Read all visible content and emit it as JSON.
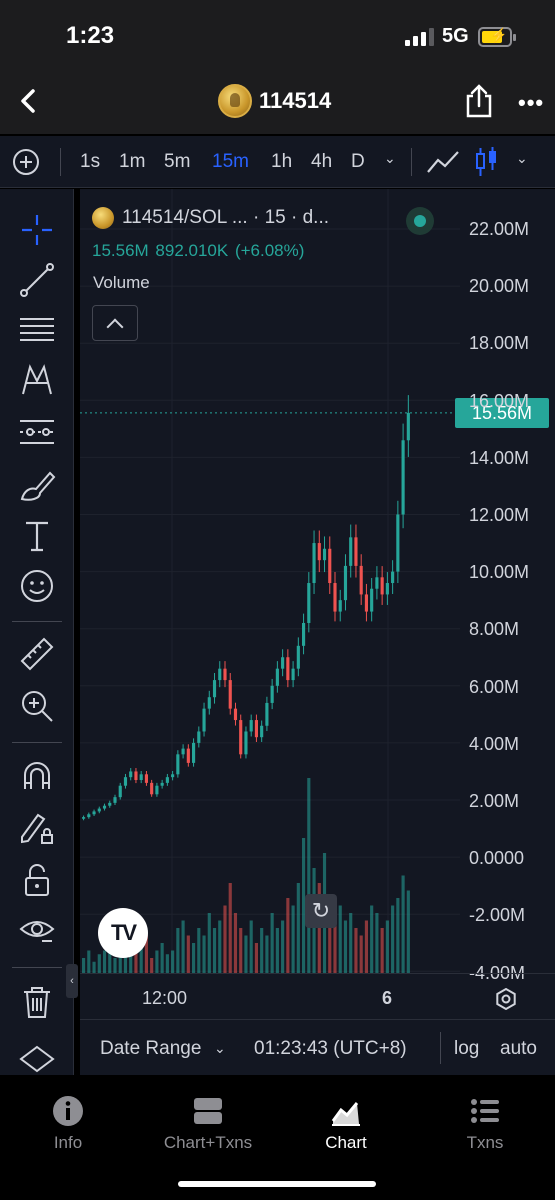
{
  "status_bar": {
    "time": "1:23",
    "network": "5G"
  },
  "header": {
    "title": "114514"
  },
  "toolbar": {
    "intervals": [
      "1s",
      "1m",
      "5m",
      "15m",
      "1h",
      "4h",
      "D"
    ],
    "active_interval": "15m"
  },
  "legend": {
    "symbol": "114514/SOL ... · 15 · d...",
    "ohlc": "15.56M 892.010K (+6.08%)",
    "volume_label": "Volume"
  },
  "price_badge": "15.56M",
  "y_axis_labels": [
    "22.00M",
    "20.00M",
    "18.00M",
    "16.00M",
    "14.00M",
    "12.00M",
    "10.00M",
    "8.00M",
    "6.00M",
    "4.00M",
    "2.00M",
    "0.0000",
    "-2.00M",
    "-4.00M"
  ],
  "x_axis": {
    "labels": [
      "12:00",
      "6"
    ]
  },
  "bottom_bar": {
    "date_range": "Date Range",
    "time": "01:23:43 (UTC+8)",
    "log": "log",
    "auto": "auto"
  },
  "tabs": [
    {
      "label": "Info",
      "icon": "info-icon"
    },
    {
      "label": "Chart+Txns",
      "icon": "split-view-icon"
    },
    {
      "label": "Chart",
      "icon": "chart-icon",
      "active": true
    },
    {
      "label": "Txns",
      "icon": "list-icon"
    }
  ],
  "colors": {
    "up": "#26a69a",
    "down": "#ef5350",
    "accent": "#2962ff",
    "background": "#131722"
  },
  "chart_data": {
    "type": "candlestick",
    "y_unit": "market cap",
    "ylim": [
      -4000000,
      22000000
    ],
    "last_price": 15560000,
    "series": [
      {
        "name": "price",
        "close": [
          1.4,
          1.5,
          1.6,
          1.7,
          1.8,
          1.9,
          2.1,
          2.5,
          2.8,
          3.0,
          2.7,
          2.9,
          2.6,
          2.2,
          2.5,
          2.6,
          2.8,
          2.9,
          3.6,
          3.8,
          3.3,
          4.0,
          4.4,
          5.2,
          5.6,
          6.2,
          6.6,
          6.2,
          5.2,
          4.8,
          3.6,
          4.4,
          4.8,
          4.2,
          4.6,
          5.4,
          6.0,
          6.6,
          7.0,
          6.2,
          6.6,
          7.4,
          8.2,
          9.6,
          11.0,
          10.4,
          10.8,
          9.6,
          8.6,
          9.0,
          10.2,
          11.2,
          10.2,
          9.2,
          8.6,
          9.4,
          9.8,
          9.2,
          9.6,
          10.0,
          12.0,
          14.6,
          15.56
        ]
      },
      {
        "name": "volume",
        "values": [
          2,
          3,
          1.5,
          2.5,
          3,
          4,
          2,
          3.5,
          5,
          4,
          3,
          6,
          5,
          2,
          3,
          4,
          2.5,
          3,
          6,
          7,
          5,
          4,
          6,
          5,
          8,
          6,
          7,
          9,
          12,
          8,
          6,
          5,
          7,
          4,
          6,
          5,
          8,
          6,
          7,
          10,
          9,
          12,
          18,
          26,
          14,
          12,
          16,
          10,
          8,
          9,
          7,
          8,
          6,
          5,
          7,
          9,
          8,
          6,
          7,
          9,
          10,
          13,
          11
        ]
      }
    ]
  }
}
